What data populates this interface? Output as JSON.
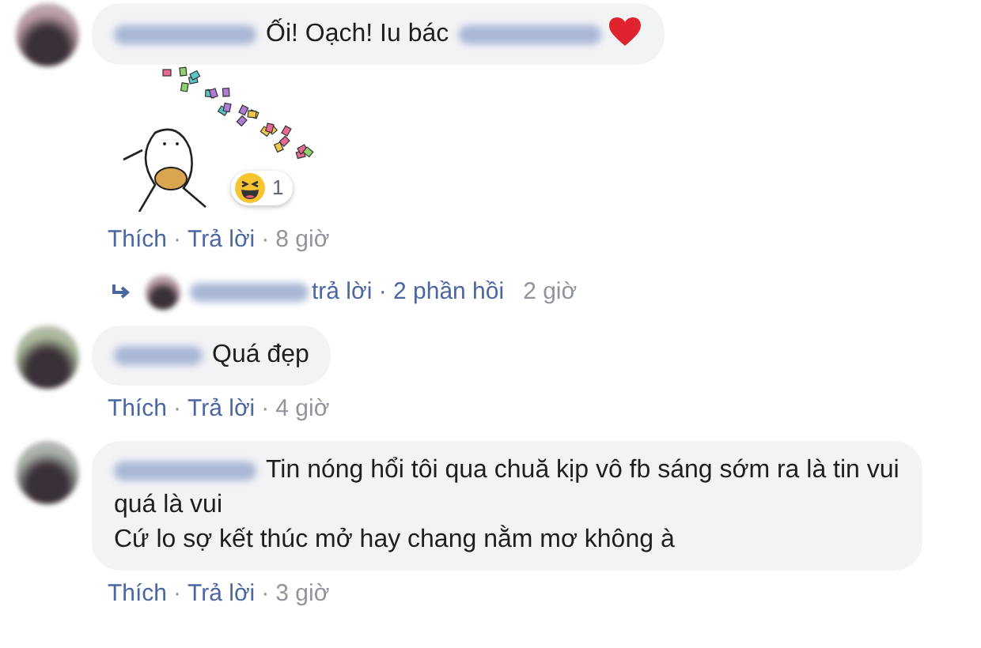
{
  "separator": "·",
  "comments": [
    {
      "name_blurred": true,
      "lines": [
        "Ối! Oạch! Iu bác"
      ],
      "mention_blurred": true,
      "heart": true,
      "attachment": {
        "kind": "sticker"
      },
      "reaction": {
        "kind": "haha",
        "count": "1"
      },
      "actions": [
        "Thích",
        "Trả lời"
      ],
      "time": "8 giờ",
      "replies": {
        "name_blurred": true,
        "text": "trả lời · 2 phần hồi",
        "time": "2 giờ"
      }
    },
    {
      "name_blurred": true,
      "lines": [
        "Quá đẹp"
      ],
      "actions": [
        "Thích",
        "Trả lời"
      ],
      "time": "4 giờ"
    },
    {
      "name_blurred": true,
      "lines": [
        "Tin nóng hổi tôi qua chuă kịp vô fb sáng sớm ra là tin vui quá là vui",
        "Cứ lo sợ kết thúc mở hay chang nằm mơ không à"
      ],
      "actions": [
        "Thích",
        "Trả lời"
      ],
      "time": "3 giờ"
    }
  ]
}
